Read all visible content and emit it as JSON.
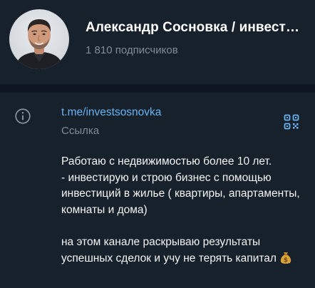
{
  "channel": {
    "title": "Александр Сосновка / инвестиции",
    "subscribers": "1 810 подписчиков"
  },
  "info": {
    "link": "t.me/investsosnovka",
    "link_caption": "Ссылка",
    "description": "Работаю с недвижимостью более 10 лет.\n- инвестирую и строю бизнес с помощью инвестиций в жилье ( квартиры, апартаменты, комнаты и дома)\n\nна этом канале раскрываю результаты успешных сделок и учу не терять капитал ",
    "icons": [
      "info-icon",
      "qr-code-icon",
      "money-bag-emoji"
    ]
  },
  "colors": {
    "background": "#17212b",
    "divider": "#0e1621",
    "accent": "#6ab3f3",
    "muted": "#7f8b97"
  }
}
